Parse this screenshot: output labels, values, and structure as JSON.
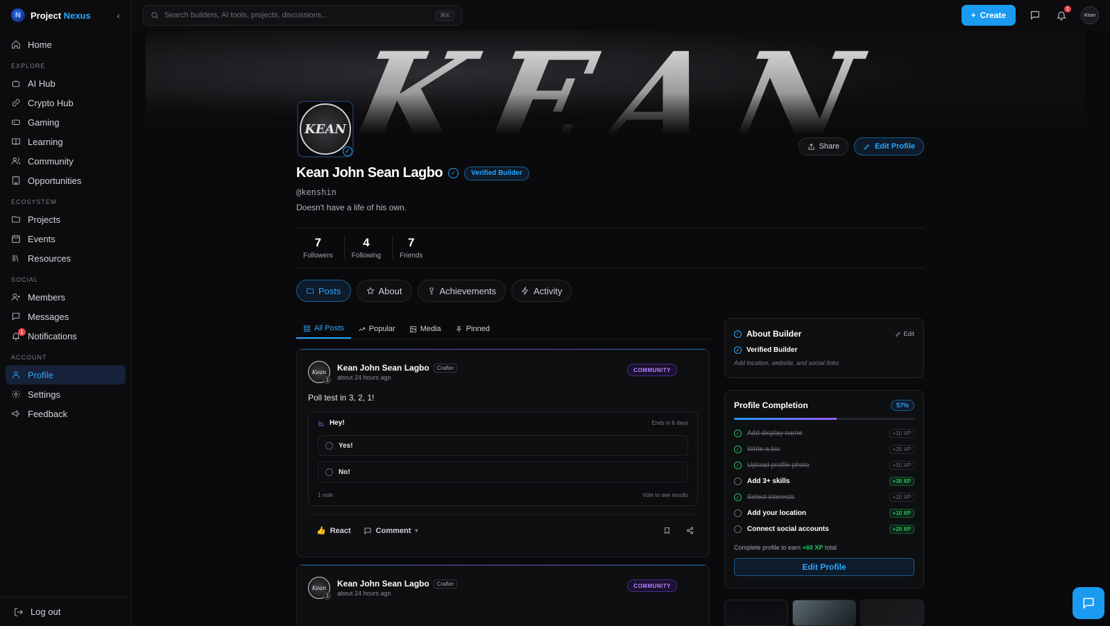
{
  "brand": {
    "name_part1": "Project",
    "name_part2": "Nexus"
  },
  "search": {
    "placeholder": "Search builders, AI tools, projects, discussions...",
    "shortcut": "⌘K"
  },
  "topbar": {
    "create_label": "Create",
    "notif_count": "1",
    "avatar_text": "Kean"
  },
  "sidebar": {
    "home": "Home",
    "sections": {
      "explore": "EXPLORE",
      "ecosystem": "ECOSYSTEM",
      "social": "SOCIAL",
      "account": "ACCOUNT"
    },
    "explore": [
      "AI Hub",
      "Crypto Hub",
      "Gaming",
      "Learning",
      "Community",
      "Opportunities"
    ],
    "ecosystem": [
      "Projects",
      "Events",
      "Resources"
    ],
    "social": [
      "Members",
      "Messages",
      "Notifications"
    ],
    "notif_badge": "1",
    "account": [
      "Profile",
      "Settings",
      "Feedback"
    ],
    "logout": "Log out"
  },
  "banner": {
    "text": "KEAN"
  },
  "profile": {
    "avatar_text": "KEAN",
    "name": "Kean John Sean Lagbo",
    "verified_label": "Verified Builder",
    "handle": "@kenshin",
    "bio": "Doesn't have a life of his own.",
    "share_label": "Share",
    "edit_label": "Edit Profile"
  },
  "stats": [
    {
      "value": "7",
      "label": "Followers"
    },
    {
      "value": "4",
      "label": "Following"
    },
    {
      "value": "7",
      "label": "Friends"
    }
  ],
  "main_tabs": [
    "Posts",
    "About",
    "Achievements",
    "Activity"
  ],
  "sub_tabs": [
    "All Posts",
    "Popular",
    "Media",
    "Pinned"
  ],
  "posts": [
    {
      "author": "Kean John Sean Lagbo",
      "role": "Crafter",
      "time": "about 24 hours ago",
      "level": "3",
      "avatar_text": "Kean",
      "tag": "COMMUNITY",
      "text": "Poll test in 3, 2, 1!",
      "poll": {
        "question": "Hey!",
        "ends": "Ends in 6 days",
        "options": [
          "Yes!",
          "No!"
        ],
        "votes": "1 vote",
        "hint": "Vote to see results"
      },
      "react_label": "React",
      "comment_label": "Comment"
    },
    {
      "author": "Kean John Sean Lagbo",
      "role": "Crafter",
      "time": "about 24 hours ago",
      "level": "3",
      "avatar_text": "Kean",
      "tag": "COMMUNITY"
    }
  ],
  "about_card": {
    "title": "About Builder",
    "edit_label": "Edit",
    "verified": "Verified Builder",
    "hint": "Add location, website, and social links"
  },
  "completion": {
    "title": "Profile Completion",
    "percent_label": "57%",
    "progress": 0.57,
    "tasks": [
      {
        "label": "Add display name",
        "xp": "+10 XP",
        "done": true
      },
      {
        "label": "Write a bio",
        "xp": "+25 XP",
        "done": true
      },
      {
        "label": "Upload profile photo",
        "xp": "+50 XP",
        "done": true
      },
      {
        "label": "Add 3+ skills",
        "xp": "+30 XP",
        "done": false
      },
      {
        "label": "Select interests",
        "xp": "+20 XP",
        "done": true
      },
      {
        "label": "Add your location",
        "xp": "+10 XP",
        "done": false
      },
      {
        "label": "Connect social accounts",
        "xp": "+20 XP",
        "done": false
      }
    ],
    "foot_prefix": "Complete profile to earn",
    "foot_xp": "+60 XP",
    "foot_suffix": "total",
    "button_label": "Edit Profile"
  }
}
